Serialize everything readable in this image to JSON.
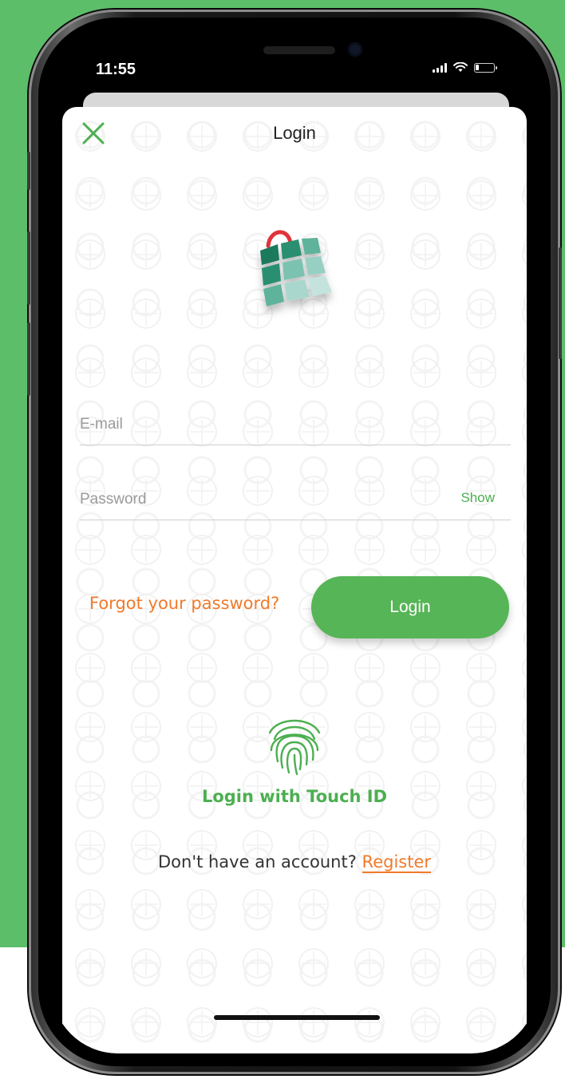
{
  "status_bar": {
    "time": "11:55"
  },
  "header": {
    "title": "Login",
    "close_icon": "close-icon"
  },
  "form": {
    "email_placeholder": "E-mail",
    "email_value": "",
    "password_placeholder": "Password",
    "password_value": "",
    "show_label": "Show"
  },
  "actions": {
    "forgot_label": "Forgot your password?",
    "login_label": "Login",
    "touch_id_label": "Login with Touch ID",
    "register_prompt": "Don't have an account?",
    "register_label": "Register"
  },
  "colors": {
    "brand_green": "#56b556",
    "accent_orange": "#f07a2a",
    "background_green": "#5dbe6a"
  }
}
